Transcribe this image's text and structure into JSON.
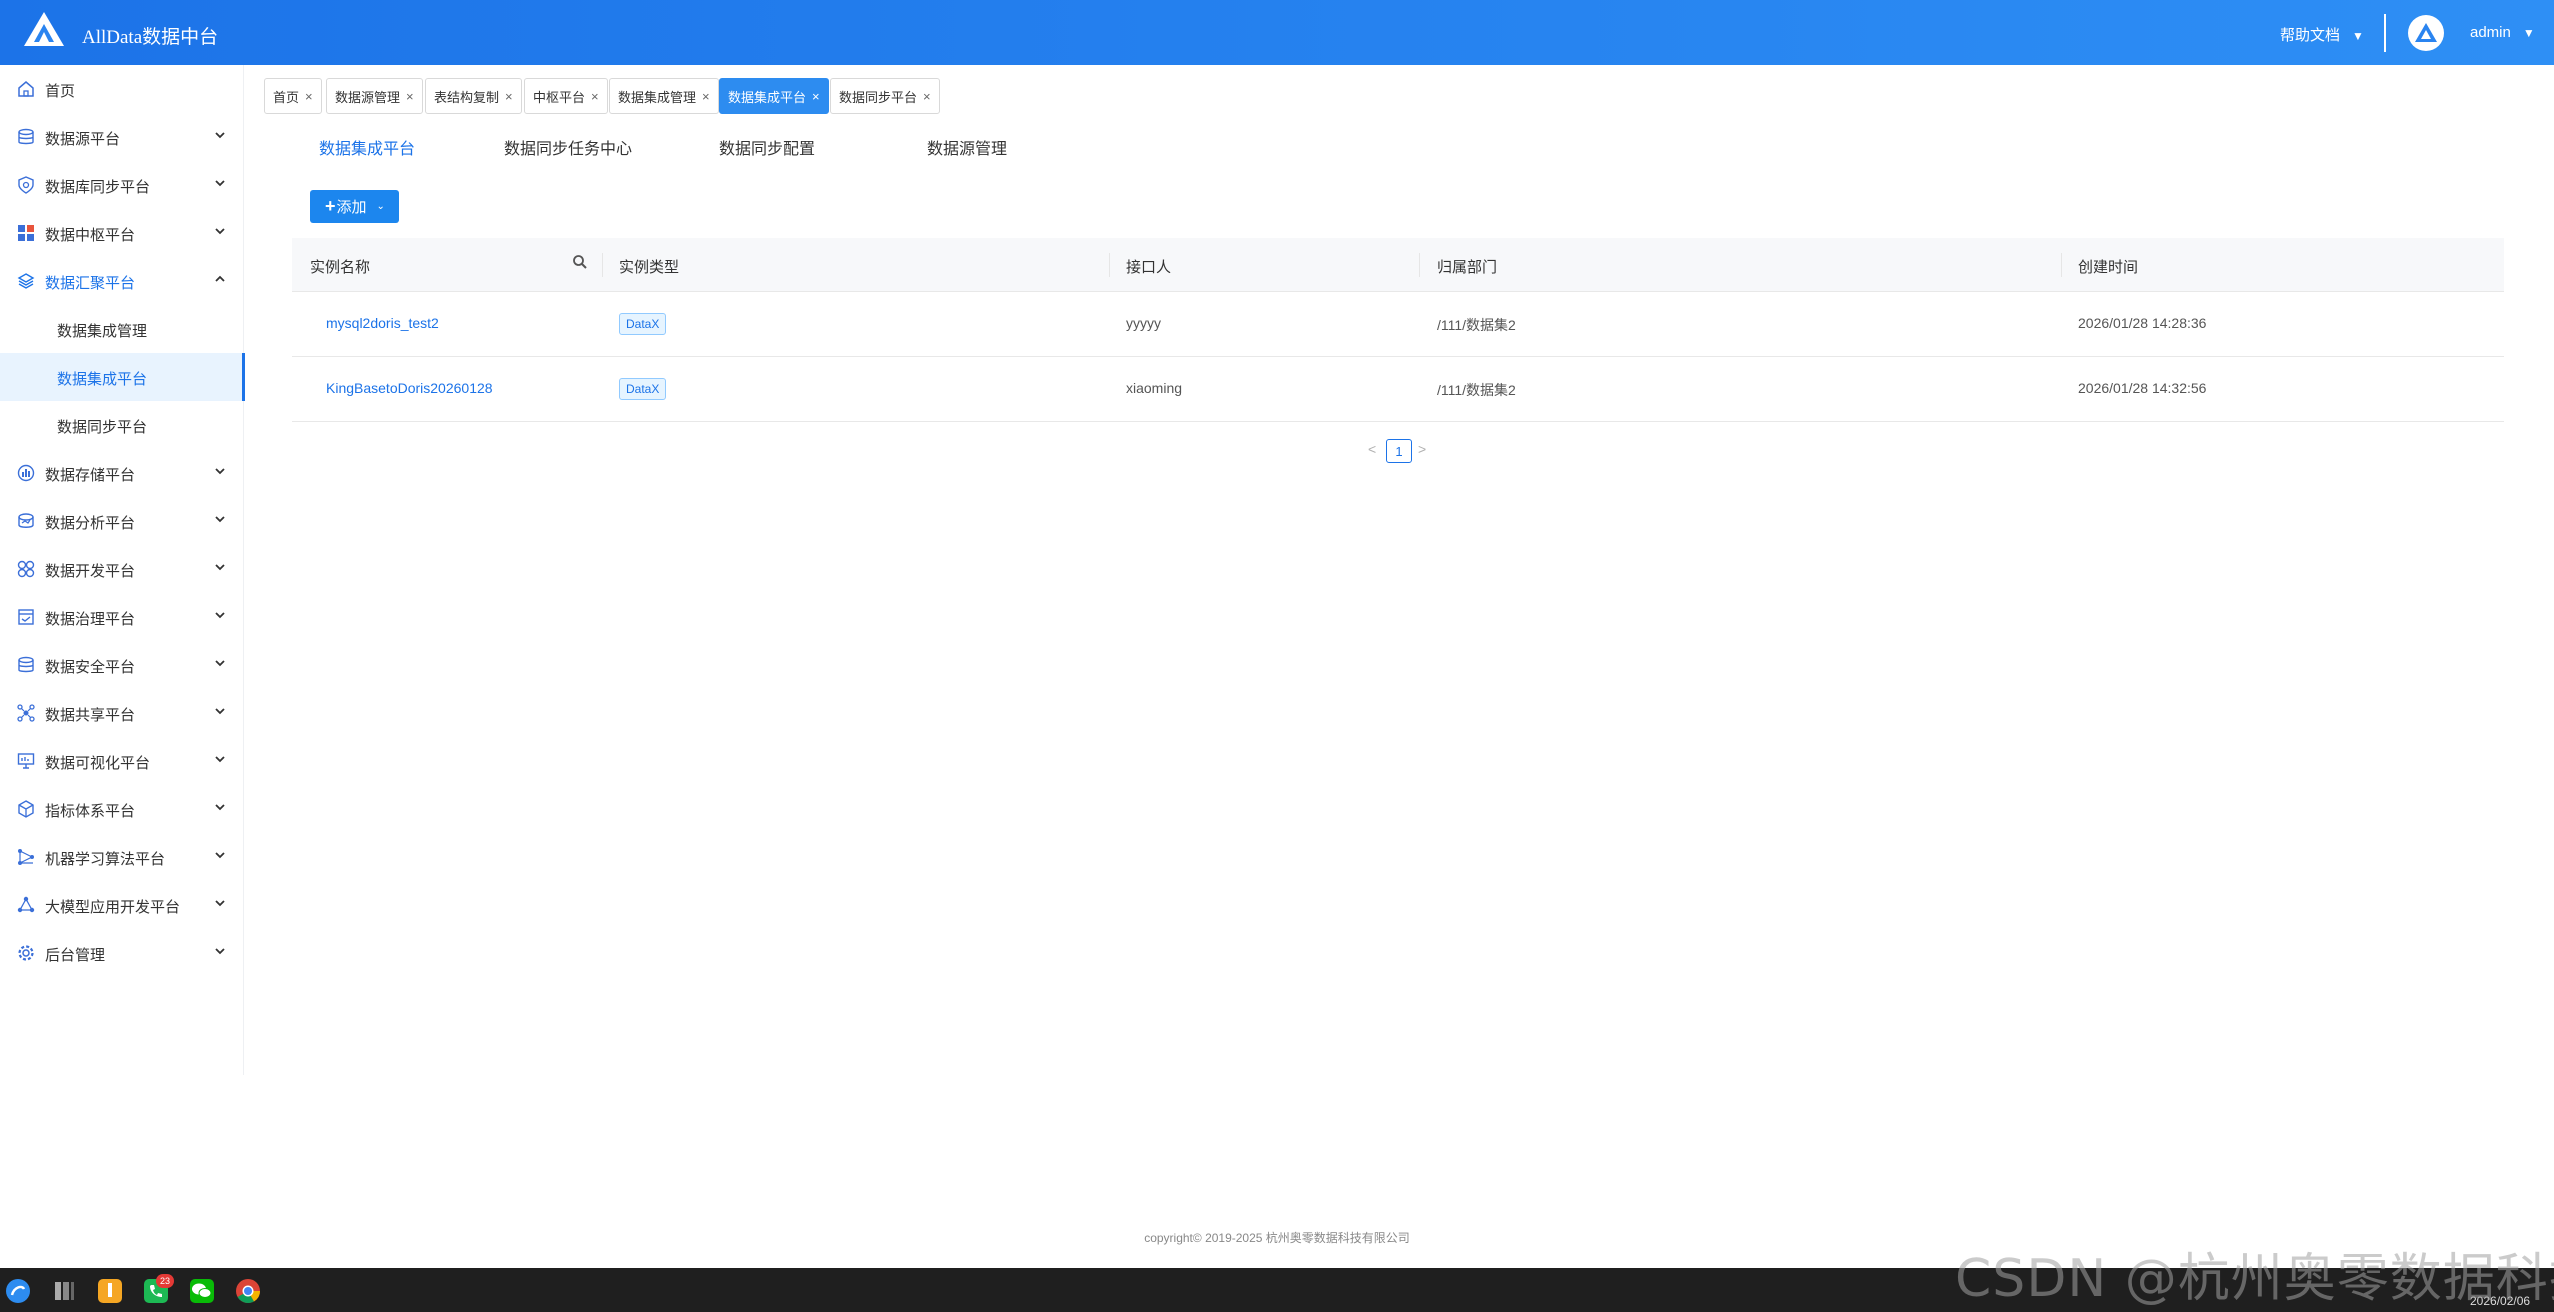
{
  "header": {
    "title": "AllData数据中台",
    "help_label": "帮助文档",
    "user_name": "admin",
    "caret": "▼"
  },
  "sidebar": {
    "items": [
      {
        "label": "首页",
        "icon": "home-icon"
      },
      {
        "label": "数据源平台",
        "icon": "database-icon"
      },
      {
        "label": "数据库同步平台",
        "icon": "shield-icon"
      },
      {
        "label": "数据中枢平台",
        "icon": "grid-icon"
      },
      {
        "label": "数据汇聚平台",
        "icon": "layers-icon"
      },
      {
        "label": "数据存储平台",
        "icon": "storage-icon"
      },
      {
        "label": "数据分析平台",
        "icon": "analysis-icon"
      },
      {
        "label": "数据开发平台",
        "icon": "dev-icon"
      },
      {
        "label": "数据治理平台",
        "icon": "governance-icon"
      },
      {
        "label": "数据安全平台",
        "icon": "security-icon"
      },
      {
        "label": "数据共享平台",
        "icon": "share-icon"
      },
      {
        "label": "数据可视化平台",
        "icon": "monitor-icon"
      },
      {
        "label": "指标体系平台",
        "icon": "cube-icon"
      },
      {
        "label": "机器学习算法平台",
        "icon": "ml-icon"
      },
      {
        "label": "大模型应用开发平台",
        "icon": "nodes-icon"
      },
      {
        "label": "后台管理",
        "icon": "gear-icon"
      }
    ],
    "subitems": [
      {
        "label": "数据集成管理"
      },
      {
        "label": "数据集成平台"
      },
      {
        "label": "数据同步平台"
      }
    ]
  },
  "tags": [
    {
      "label": "首页"
    },
    {
      "label": "数据源管理"
    },
    {
      "label": "表结构复制"
    },
    {
      "label": "中枢平台"
    },
    {
      "label": "数据集成管理"
    },
    {
      "label": "数据集成平台"
    },
    {
      "label": "数据同步平台"
    }
  ],
  "tag_close": "×",
  "subtabs": [
    {
      "label": "数据集成平台"
    },
    {
      "label": "数据同步任务中心"
    },
    {
      "label": "数据同步配置"
    },
    {
      "label": "数据源管理"
    }
  ],
  "add_button": {
    "plus": "+",
    "label": "添加",
    "dropdown": "⌄"
  },
  "table": {
    "columns": [
      "实例名称",
      "实例类型",
      "接口人",
      "归属部门",
      "创建时间"
    ],
    "rows": [
      {
        "name": "mysql2doris_test2",
        "type": "DataX",
        "contact": "yyyyy",
        "dept": "/111/数据集2",
        "created": "2026/01/28 14:28:36"
      },
      {
        "name": "KingBasetoDoris20260128",
        "type": "DataX",
        "contact": "xiaoming",
        "dept": "/111/数据集2",
        "created": "2026/01/28 14:32:56"
      }
    ]
  },
  "pagination": {
    "prev": "<",
    "page": "1",
    "next": ">"
  },
  "footer": {
    "copyright": "copyright© 2019-2025 杭州奥零数据科技有限公司"
  },
  "taskbar": {
    "badge": "23",
    "date": "2026/02/06",
    "apps": [
      "assistant-icon",
      "files-icon",
      "notes-icon",
      "phone-icon",
      "wechat-icon",
      "chrome-icon"
    ]
  },
  "watermark": "CSDN @杭州奥零数据科技",
  "colors": {
    "accent": "#1c73e8",
    "header_start": "#1c73e8",
    "header_end": "#2e8ff5",
    "active_tag": "#2d8cf0",
    "add_button": "#1c86ee"
  }
}
